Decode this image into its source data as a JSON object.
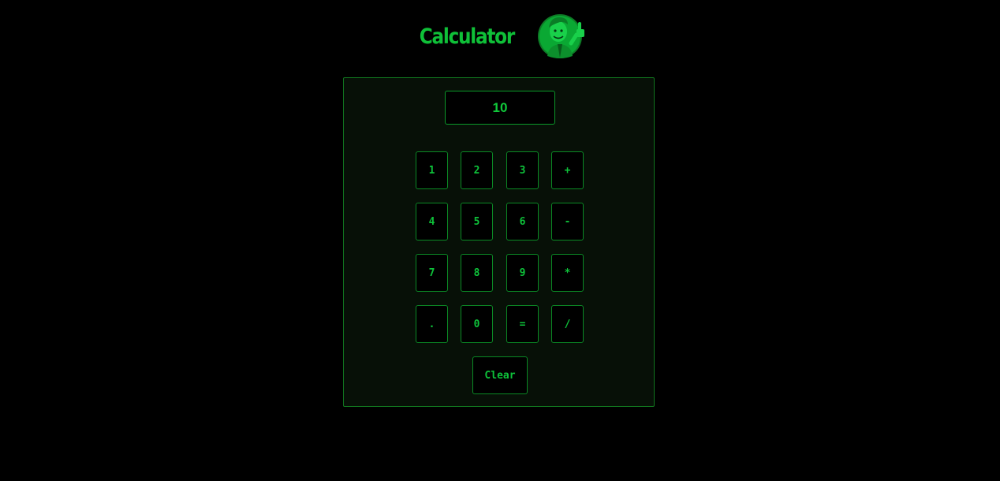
{
  "header": {
    "title": "Calculator",
    "mascot_icon": "vault-boy-thumbs-up-icon"
  },
  "display": {
    "value": "10"
  },
  "keypad": {
    "rows": [
      [
        "1",
        "2",
        "3",
        "+"
      ],
      [
        "4",
        "5",
        "6",
        "-"
      ],
      [
        "7",
        "8",
        "9",
        "*"
      ],
      [
        ".",
        "0",
        "=",
        "/"
      ]
    ],
    "clear_label": "Clear"
  },
  "colors": {
    "background": "#000000",
    "panel": "#071007",
    "accent": "#0fc038",
    "border": "#11761f"
  }
}
